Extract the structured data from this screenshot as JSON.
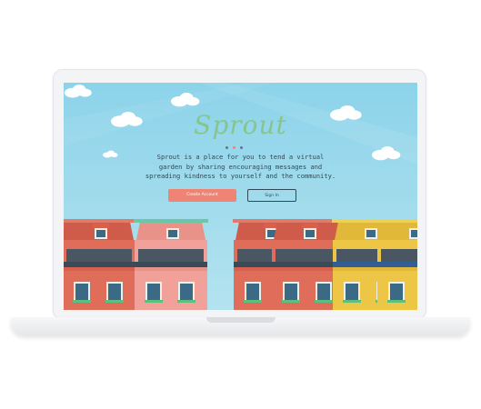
{
  "app": {
    "logo": "Sprout",
    "tagline": "Sprout is a place for you to tend a virtual garden by sharing encouraging messages and spreading kindness to yourself and the community."
  },
  "actions": {
    "create_account": "Create Account",
    "sign_in": "Sign In"
  },
  "carousel": {
    "dot_count": 3,
    "active_index": 1
  },
  "colors": {
    "sky": "#8cd3ea",
    "logo_green": "#86c58d",
    "accent_coral": "#ef8474",
    "text_dark": "#2f4a55",
    "house_red": "#e06c5a",
    "house_pink": "#f2a19a",
    "house_yellow": "#eec646"
  }
}
